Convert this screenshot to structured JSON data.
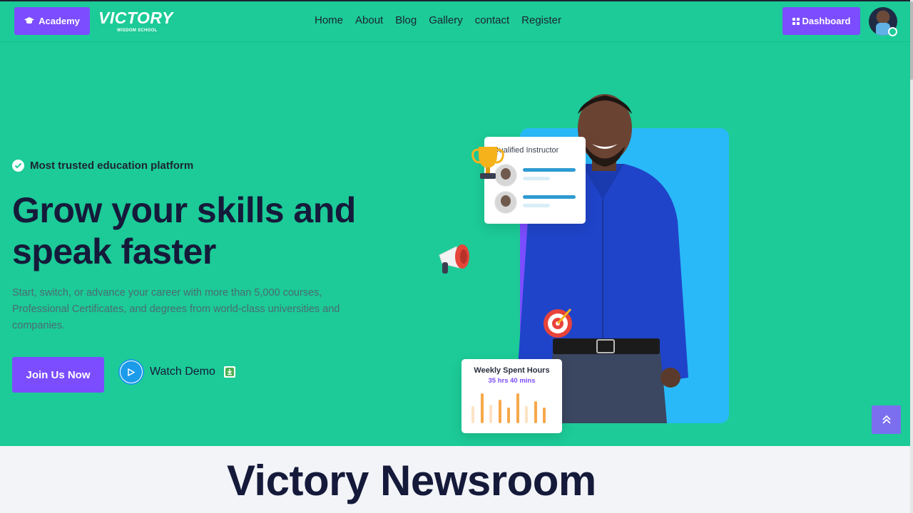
{
  "header": {
    "academy_label": "Academy",
    "logo_text": "VICTORY",
    "logo_subtext": "WISDOM SCHOOL",
    "nav": [
      "Home",
      "About",
      "Blog",
      "Gallery",
      "contact",
      "Register"
    ],
    "dashboard_label": "Dashboard"
  },
  "hero": {
    "trusted_text": "Most trusted education platform",
    "headline_line1": "Grow your skills and",
    "headline_line2": "speak faster",
    "description": "Start, switch, or advance your career with more than 5,000 courses, Professional Certificates, and degrees from world-class universities and companies.",
    "join_label": "Join Us Now",
    "demo_label": "Watch Demo"
  },
  "instructor_card": {
    "title": "Qualified Instructor"
  },
  "weekly_card": {
    "title": "Weekly Spent Hours",
    "value": "35 hrs 40 mins",
    "bars": [
      {
        "level": 0.55,
        "color": "#fde3c4"
      },
      {
        "level": 0.95,
        "color": "#f7a84a"
      },
      {
        "level": 0.6,
        "color": "#fde3c4"
      },
      {
        "level": 0.75,
        "color": "#f7a84a"
      },
      {
        "level": 0.5,
        "color": "#f7a84a"
      },
      {
        "level": 0.95,
        "color": "#f7a84a"
      },
      {
        "level": 0.55,
        "color": "#fde3c4"
      },
      {
        "level": 0.7,
        "color": "#f7a84a"
      },
      {
        "level": 0.5,
        "color": "#f7a84a"
      }
    ]
  },
  "newsroom_title": "Victory Newsroom",
  "colors": {
    "hero_bg": "#1ccb97",
    "accent": "#7c4dff",
    "panel_blue": "#29b9f8",
    "heading": "#151a3a"
  }
}
